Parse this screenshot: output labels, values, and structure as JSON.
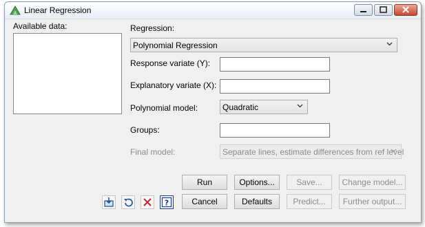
{
  "window": {
    "title": "Linear Regression",
    "accent": "#3b8e46"
  },
  "left": {
    "available_label": "Available data:"
  },
  "form": {
    "regression_label": "Regression:",
    "regression_value": "Polynomial Regression",
    "response_label": "Response variate (Y):",
    "response_value": "",
    "explanatory_label": "Explanatory variate (X):",
    "explanatory_value": "",
    "poly_model_label": "Polynomial model:",
    "poly_model_value": "Quadratic",
    "groups_label": "Groups:",
    "groups_value": "",
    "final_model_label": "Final model:",
    "final_model_value": "Separate lines, estimate differences from ref level"
  },
  "buttons": {
    "run": "Run",
    "options": "Options...",
    "save": "Save...",
    "change_model": "Change model...",
    "cancel": "Cancel",
    "defaults": "Defaults",
    "predict": "Predict...",
    "further_output": "Further output..."
  },
  "icons": [
    "pin-icon",
    "undo-icon",
    "clear-icon",
    "help-icon"
  ]
}
